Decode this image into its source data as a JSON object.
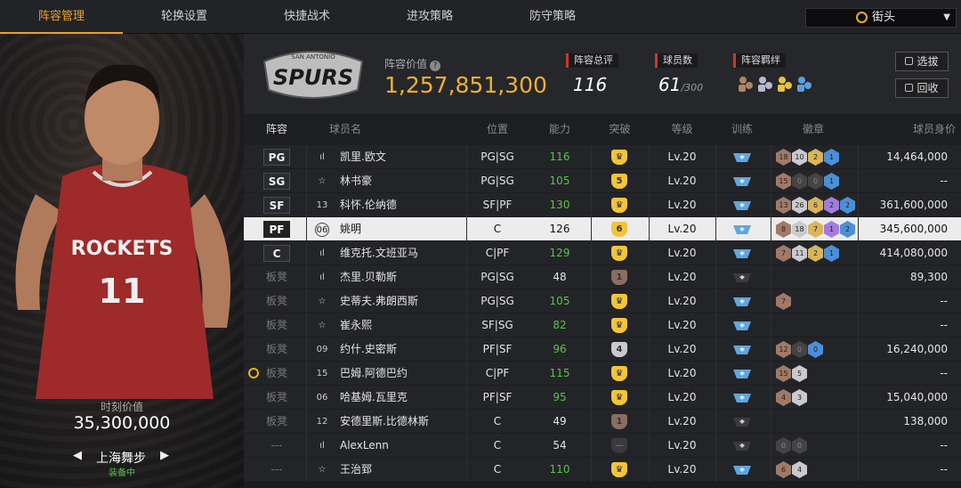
{
  "tabs": [
    {
      "label": "阵容管理",
      "active": true
    },
    {
      "label": "轮换设置",
      "active": false
    },
    {
      "label": "快捷战术",
      "active": false
    },
    {
      "label": "进攻策略",
      "active": false
    },
    {
      "label": "防守策略",
      "active": false
    }
  ],
  "district": {
    "label": "街头",
    "icon": "alarm-clock-icon"
  },
  "featured": {
    "market_label": "时刻价值",
    "market_value": "35,300,000",
    "coach_name": "上海舞步",
    "coach_status": "装备中",
    "jersey_text": "ROCKETS",
    "jersey_number": "11"
  },
  "team": {
    "logo_text": "SPURS",
    "logo_sub": "SAN ANTONIO",
    "lineup_value_label": "阵容价值",
    "lineup_value": "1,257,851,300"
  },
  "stats": {
    "overall_label": "阵容总评",
    "overall_value": "116",
    "count_label": "球员数",
    "count_value": "61",
    "count_max": "/300",
    "chem_label": "阵容羁绊"
  },
  "buttons": {
    "pick": "选拔",
    "recycle": "回收"
  },
  "columns": [
    "阵容",
    "球员名",
    "位置",
    "能力",
    "突破",
    "等级",
    "训练",
    "徽章",
    "球员身价"
  ],
  "colors": {
    "accent": "#e8a030",
    "green": "#5bc24b",
    "gold_shield": "#f0c53a",
    "bronze_shield": "#8a6e62",
    "silver_shield": "#c9c9cf"
  },
  "rows": [
    {
      "slot": "PG",
      "starter": true,
      "icon": "bars",
      "name": "凯里.欧文",
      "pos": "PG|SG",
      "ovr": "116",
      "ovr_green": true,
      "bt": "crown",
      "btc": "gold",
      "lvl": "Lv.20",
      "train": "blue",
      "badges": [
        [
          "18",
          "bronze"
        ],
        [
          "10",
          "silver"
        ],
        [
          "2",
          "gold"
        ],
        [
          "1",
          "blue"
        ]
      ],
      "value": "14,464,000"
    },
    {
      "slot": "SG",
      "starter": true,
      "icon": "star",
      "name": "林书豪",
      "pos": "PG|SG",
      "ovr": "105",
      "ovr_green": true,
      "bt": "5",
      "btc": "gold",
      "lvl": "Lv.20",
      "train": "blue",
      "badges": [
        [
          "15",
          "bronze"
        ],
        [
          "0",
          "dark"
        ],
        [
          "0",
          "dark"
        ],
        [
          "1",
          "blue"
        ]
      ],
      "value": "--"
    },
    {
      "slot": "SF",
      "starter": true,
      "icon": "13",
      "name": "科怀.伦纳德",
      "pos": "SF|PF",
      "ovr": "130",
      "ovr_green": true,
      "bt": "crown",
      "btc": "gold",
      "lvl": "Lv.20",
      "train": "blue",
      "badges": [
        [
          "13",
          "bronze"
        ],
        [
          "26",
          "silver"
        ],
        [
          "6",
          "gold"
        ],
        [
          "2",
          "purple"
        ],
        [
          "2",
          "blue"
        ]
      ],
      "value": "361,600,000"
    },
    {
      "slot": "PF",
      "starter": true,
      "selected": true,
      "icon": "06",
      "name": "姚明",
      "pos": "C",
      "ovr": "126",
      "ovr_green": false,
      "bt": "6",
      "btc": "gold",
      "lvl": "Lv.20",
      "train": "blue",
      "badges": [
        [
          "8",
          "bronze"
        ],
        [
          "18",
          "silver"
        ],
        [
          "7",
          "gold"
        ],
        [
          "1",
          "purple"
        ],
        [
          "2",
          "blue"
        ]
      ],
      "value": "345,600,000"
    },
    {
      "slot": "C",
      "starter": true,
      "icon": "bars",
      "name": "维克托.文班亚马",
      "pos": "C|PF",
      "ovr": "129",
      "ovr_green": true,
      "bt": "crown",
      "btc": "gold",
      "lvl": "Lv.20",
      "train": "blue",
      "badges": [
        [
          "7",
          "bronze"
        ],
        [
          "11",
          "silver"
        ],
        [
          "2",
          "gold"
        ],
        [
          "1",
          "blue"
        ]
      ],
      "value": "414,080,000"
    },
    {
      "slot": "板凳",
      "starter": false,
      "icon": "bars",
      "name": "杰里.贝勒斯",
      "pos": "PG|SG",
      "ovr": "48",
      "ovr_green": false,
      "bt": "1",
      "btc": "bronze",
      "lvl": "Lv.20",
      "train": "dark",
      "badges": [],
      "value": "89,300"
    },
    {
      "slot": "板凳",
      "starter": false,
      "icon": "star",
      "name": "史蒂夫.弗朗西斯",
      "pos": "PG|SG",
      "ovr": "105",
      "ovr_green": true,
      "bt": "crown",
      "btc": "gold",
      "lvl": "Lv.20",
      "train": "blue",
      "badges": [
        [
          "7",
          "bronze"
        ]
      ],
      "value": "--"
    },
    {
      "slot": "板凳",
      "starter": false,
      "icon": "star",
      "name": "崔永熙",
      "pos": "SF|SG",
      "ovr": "82",
      "ovr_green": true,
      "bt": "crown",
      "btc": "gold",
      "lvl": "Lv.20",
      "train": "blue",
      "badges": [],
      "value": "--"
    },
    {
      "slot": "板凳",
      "starter": false,
      "icon": "09",
      "name": "约什.史密斯",
      "pos": "PF|SF",
      "ovr": "96",
      "ovr_green": true,
      "bt": "4",
      "btc": "silver",
      "lvl": "Lv.20",
      "train": "blue",
      "badges": [
        [
          "12",
          "bronze"
        ],
        [
          "0",
          "dark"
        ],
        [
          "0",
          "blue"
        ]
      ],
      "value": "16,240,000"
    },
    {
      "slot": "板凳",
      "starter": false,
      "alarm": true,
      "icon": "15",
      "name": "巴姆.阿德巴约",
      "pos": "C|PF",
      "ovr": "115",
      "ovr_green": true,
      "bt": "crown",
      "btc": "gold",
      "lvl": "Lv.20",
      "train": "blue",
      "badges": [
        [
          "15",
          "bronze"
        ],
        [
          "5",
          "silver"
        ]
      ],
      "value": "--"
    },
    {
      "slot": "板凳",
      "starter": false,
      "icon": "06",
      "name": "哈基姆.瓦里克",
      "pos": "PF|SF",
      "ovr": "95",
      "ovr_green": true,
      "bt": "crown",
      "btc": "gold",
      "lvl": "Lv.20",
      "train": "blue",
      "badges": [
        [
          "4",
          "bronze"
        ],
        [
          "3",
          "silver"
        ]
      ],
      "value": "15,040,000"
    },
    {
      "slot": "板凳",
      "starter": false,
      "icon": "12",
      "name": "安德里斯.比德林斯",
      "pos": "C",
      "ovr": "49",
      "ovr_green": false,
      "bt": "1",
      "btc": "bronze",
      "lvl": "Lv.20",
      "train": "dark",
      "badges": [],
      "value": "138,000"
    },
    {
      "slot": "---",
      "starter": false,
      "icon": "bars",
      "name": "AlexLenn",
      "pos": "C",
      "ovr": "54",
      "ovr_green": false,
      "bt": "dash",
      "btc": "dark",
      "lvl": "Lv.20",
      "train": "dark",
      "badges": [
        [
          "0",
          "dark"
        ],
        [
          "0",
          "dark"
        ]
      ],
      "value": "--"
    },
    {
      "slot": "---",
      "starter": false,
      "icon": "star",
      "name": "王治郅",
      "pos": "C",
      "ovr": "110",
      "ovr_green": true,
      "bt": "crown",
      "btc": "gold",
      "lvl": "Lv.20",
      "train": "blue",
      "badges": [
        [
          "6",
          "bronze"
        ],
        [
          "4",
          "silver"
        ]
      ],
      "value": "--"
    }
  ]
}
